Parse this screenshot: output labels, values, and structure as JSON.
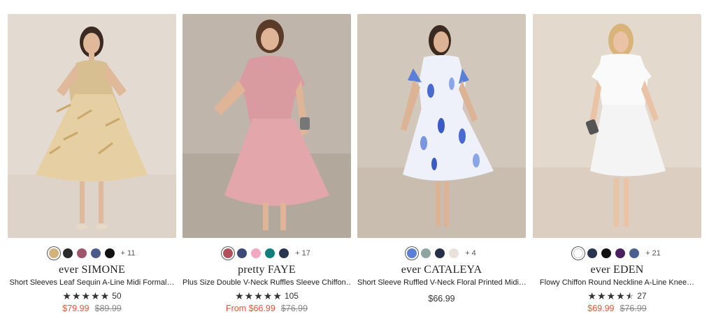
{
  "products": [
    {
      "swatches": [
        "#d4b27c",
        "#2b2b2b",
        "#a0566a",
        "#4a5a8a",
        "#111111"
      ],
      "more": "+ 11",
      "brand": "ever SIMONE",
      "title": "Short Sleeves Leaf Sequin A-Line Midi Formal…",
      "rating_count": "50",
      "sale_price": "$79.99",
      "orig_price": "$89.99"
    },
    {
      "swatches": [
        "#b0505f",
        "#3c4a7a",
        "#f2a8c0",
        "#0e7f7a",
        "#2a3550"
      ],
      "more": "+ 17",
      "brand": "pretty FAYE",
      "title": "Plus Size Double V-Neck Ruffles Sleeve Chiffon…",
      "rating_count": "105",
      "sale_price": "From $66.99",
      "orig_price": "$76.99"
    },
    {
      "swatches": [
        "#5b7fd6",
        "#8fa6a0",
        "#253048",
        "#e9e2da"
      ],
      "more": "+ 4",
      "brand": "ever CATALEYA",
      "title": "Short Sleeve Ruffled V-Neck Floral Printed Midi…",
      "price": "$66.99"
    },
    {
      "swatches": [
        "#ffffff",
        "#283452",
        "#111111",
        "#4a2060",
        "#4a6090"
      ],
      "more": "+ 21",
      "brand": "ever EDEN",
      "title": "Flowy Chiffon Round Neckline A-Line Knee…",
      "rating_count": "27",
      "sale_price": "$69.99",
      "orig_price": "$76.99"
    }
  ],
  "colors": {
    "sale": "#e8543e",
    "star": "#333333"
  }
}
